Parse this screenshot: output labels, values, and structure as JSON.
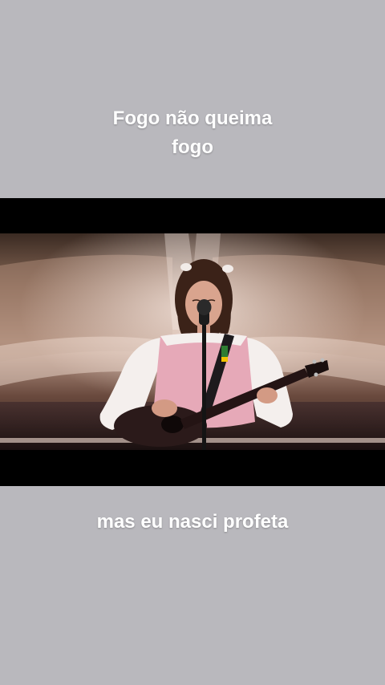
{
  "captions": {
    "top_line_1": "Fogo não queima",
    "top_line_2": "fogo",
    "bottom": "mas eu nasci profeta"
  },
  "colors": {
    "background": "#b9b8bd",
    "caption_text": "#ffffff",
    "letterbox": "#000000"
  }
}
